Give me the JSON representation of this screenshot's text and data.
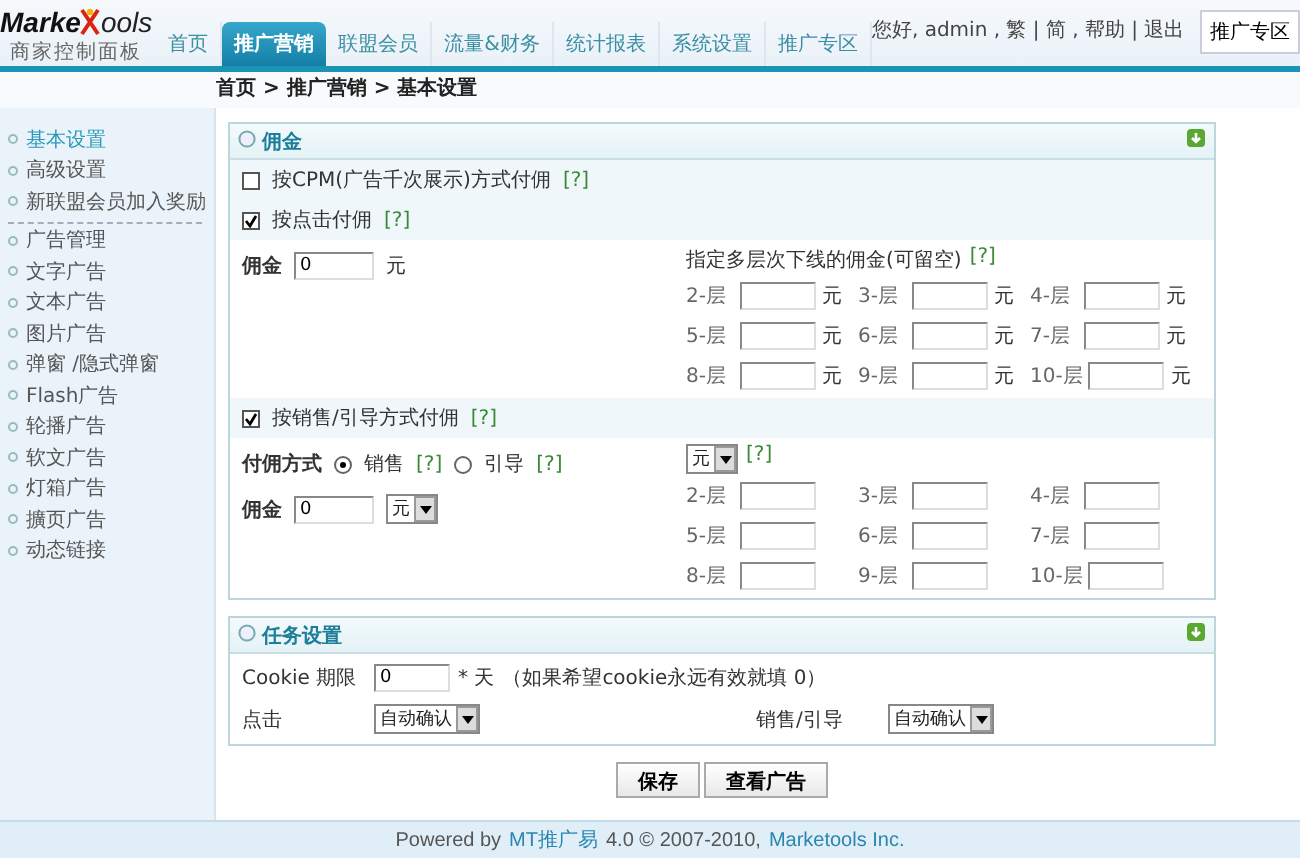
{
  "header": {
    "logo": {
      "left": "Marke",
      "right": "ools",
      "subtitle": "商家控制面板"
    },
    "nav": [
      {
        "label": "首页",
        "selected": false
      },
      {
        "label": "推广营销",
        "selected": true
      },
      {
        "label": "联盟会员",
        "selected": false
      },
      {
        "label": "流量&财务",
        "selected": false
      },
      {
        "label": "统计报表",
        "selected": false
      },
      {
        "label": "系统设置",
        "selected": false
      },
      {
        "label": "推广专区",
        "selected": false
      }
    ],
    "user_links": "您好, admin , 繁 | 简 , 帮助 | 退出",
    "zone_button": "推广专区"
  },
  "breadcrumb": "首页 > 推广营销 > 基本设置",
  "sidebar": {
    "groups": [
      [
        {
          "label": "基本设置",
          "selected": true
        },
        {
          "label": "高级设置",
          "selected": false
        },
        {
          "label": "新联盟会员加入奖励",
          "selected": false
        }
      ],
      [
        {
          "label": "广告管理",
          "selected": false
        },
        {
          "label": "文字广告",
          "selected": false
        },
        {
          "label": "文本广告",
          "selected": false
        },
        {
          "label": "图片广告",
          "selected": false
        },
        {
          "label": "弹窗 /隐式弹窗",
          "selected": false
        },
        {
          "label": "Flash广告",
          "selected": false
        },
        {
          "label": "轮播广告",
          "selected": false
        },
        {
          "label": "软文广告",
          "selected": false
        },
        {
          "label": "灯箱广告",
          "selected": false
        },
        {
          "label": "擴页广告",
          "selected": false
        },
        {
          "label": "动态链接",
          "selected": false
        }
      ]
    ]
  },
  "commission": {
    "title": "佣金",
    "cpm": {
      "label": "按CPM(广告千次展示)方式付佣",
      "checked": false,
      "help": "[?]"
    },
    "click": {
      "label": "按点击付佣",
      "checked": true,
      "help": "[?]",
      "amount_label": "佣金",
      "amount_value": "0",
      "unit": "元",
      "tiers_title": "指定多层次下线的佣金(可留空)",
      "tiers_help": "[?]",
      "tiers": [
        {
          "label": "2-层",
          "unit": "元"
        },
        {
          "label": "3-层",
          "unit": "元"
        },
        {
          "label": "4-层",
          "unit": "元"
        },
        {
          "label": "5-层",
          "unit": "元"
        },
        {
          "label": "6-层",
          "unit": "元"
        },
        {
          "label": "7-层",
          "unit": "元"
        },
        {
          "label": "8-层",
          "unit": "元"
        },
        {
          "label": "9-层",
          "unit": "元"
        },
        {
          "label": "10-层",
          "unit": "元"
        }
      ]
    },
    "sales": {
      "label": "按销售/引导方式付佣",
      "checked": true,
      "help": "[?]",
      "method_label": "付佣方式",
      "methods": [
        {
          "label": "销售",
          "selected": true,
          "help": "[?]"
        },
        {
          "label": "引导",
          "selected": false,
          "help": "[?]"
        }
      ],
      "amount_label": "佣金",
      "amount_value": "0",
      "unit_select": "元",
      "tier_unit_select": "元",
      "tier_help": "[?]",
      "tiers": [
        {
          "label": "2-层"
        },
        {
          "label": "3-层"
        },
        {
          "label": "4-层"
        },
        {
          "label": "5-层"
        },
        {
          "label": "6-层"
        },
        {
          "label": "7-层"
        },
        {
          "label": "8-层"
        },
        {
          "label": "9-层"
        },
        {
          "label": "10-层"
        }
      ]
    }
  },
  "tasks": {
    "title": "任务设置",
    "cookie_label": "Cookie 期限",
    "cookie_value": "0",
    "cookie_unit": "* 天",
    "cookie_note": "（如果希望cookie永远有效就填 0）",
    "click_label": "点击",
    "click_select": "自动确认",
    "sales_label": "销售/引导",
    "sales_select": "自动确认"
  },
  "buttons": [
    "保存",
    "查看广告"
  ],
  "footer": {
    "prefix": "Powered by",
    "product": "MT推广易",
    "version": "4.0 © 2007-2010,",
    "company": "Marketools Inc."
  }
}
